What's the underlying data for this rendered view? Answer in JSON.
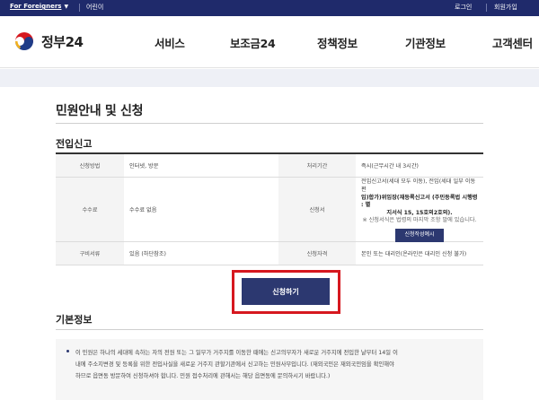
{
  "topbar": {
    "foreigners_label": "For Foreigners",
    "kids_label": "어린이",
    "login_label": "로그인",
    "join_label": "회원가입"
  },
  "header": {
    "logo_text": "정부24",
    "nav": [
      "서비스",
      "보조금24",
      "정책정보",
      "기관정보",
      "고객센터"
    ]
  },
  "main": {
    "page_title": "민원안내 및 신청",
    "section_title": "전입신고",
    "table": {
      "row1": {
        "label_a": "신청방법",
        "value_a": "인터넷, 방문",
        "label_b": "처리기간",
        "value_b": "즉시(근무시간 내 3시간)"
      },
      "row2": {
        "label_a": "수수료",
        "value_a": "수수료 없음",
        "label_b": "신청서",
        "doc_line1": "전입신고서(세대 모두 이동), 전입(세대 일부 이동 편",
        "doc_line2": "입)합가)위임장(재등록신고서 (주민등록법 시행령 : 별",
        "doc_line3": "지서식 15, 15호의2호의).",
        "doc_note": "※ 신청서식은 법령의 마지막 조항 말에 있습니다.",
        "sample_button": "신청작성예시"
      },
      "row3": {
        "label_a": "구비서류",
        "value_a": "있음 (하단참조)",
        "label_b": "신청자격",
        "value_b": "본인 또는 대리인(온라인은 대리인 신청 불가)"
      }
    },
    "apply_button": "신청하기",
    "basic_title": "기본정보",
    "basic_line1": "이 민원은 하나의 세대에 속하는 자의 전원 또는 그 일부가 거주지를 이동한 때에는 신고의무자가 새로운 거주지에 전입한 날부터 14일 이",
    "basic_line2": "내에 주소지변경 및 등록을 위한 전입사실을 새로운 거주지 관할기관에서 신고하는 민원사무입니다. (재외국민은 재외국민임을 확인해야",
    "basic_line3": "하므로 읍면동 방문하여 신청하셔야 합니다. 민원 접수처리에 관해서는 해당 읍면동에 문의하시기 바랍니다.)"
  },
  "colors": {
    "topbar": "#1f2a6b",
    "primary_button": "#2c3870",
    "highlight_border": "#d6181f"
  }
}
